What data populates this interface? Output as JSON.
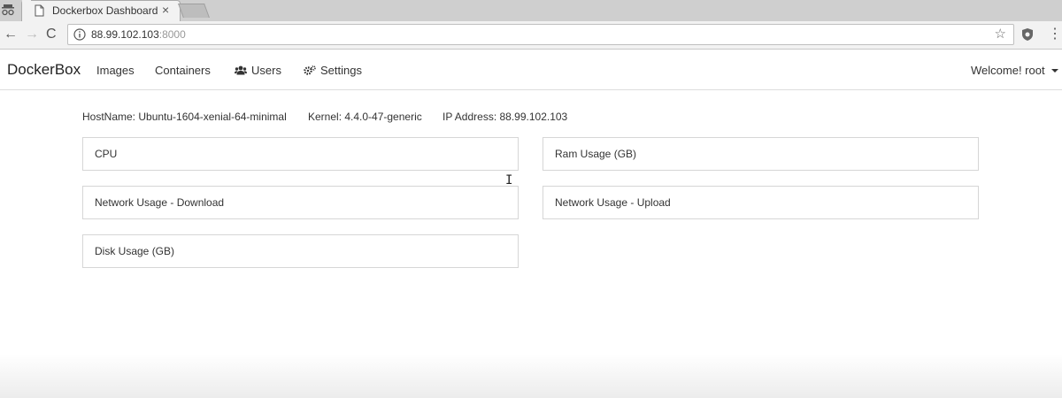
{
  "browser": {
    "tab_title": "Dockerbox Dashboard",
    "tab_close": "×",
    "url_host": "88.99.102.103",
    "url_port": ":8000",
    "back": "←",
    "forward": "→",
    "reload": "C",
    "star": "☆",
    "menu": "⋮"
  },
  "navbar": {
    "brand": "DockerBox",
    "images": "Images",
    "containers": "Containers",
    "users": "Users",
    "settings": "Settings",
    "welcome": "Welcome! root",
    "icons": {
      "users": "users-icon",
      "settings": "cogs-icon"
    }
  },
  "host": {
    "hostname": "HostName: Ubuntu-1604-xenial-64-minimal",
    "kernel": "Kernel: 4.4.0-47-generic",
    "ip": "IP Address: 88.99.102.103"
  },
  "panels": {
    "cpu": "CPU",
    "ram": "Ram Usage (GB)",
    "net_download": "Network Usage - Download",
    "net_upload": "Network Usage - Upload",
    "disk": "Disk Usage (GB)"
  },
  "colors": {
    "tabstrip": "#cfcfcf",
    "toolbar": "#f2f2f2",
    "panel_border": "#d6d6d6"
  }
}
